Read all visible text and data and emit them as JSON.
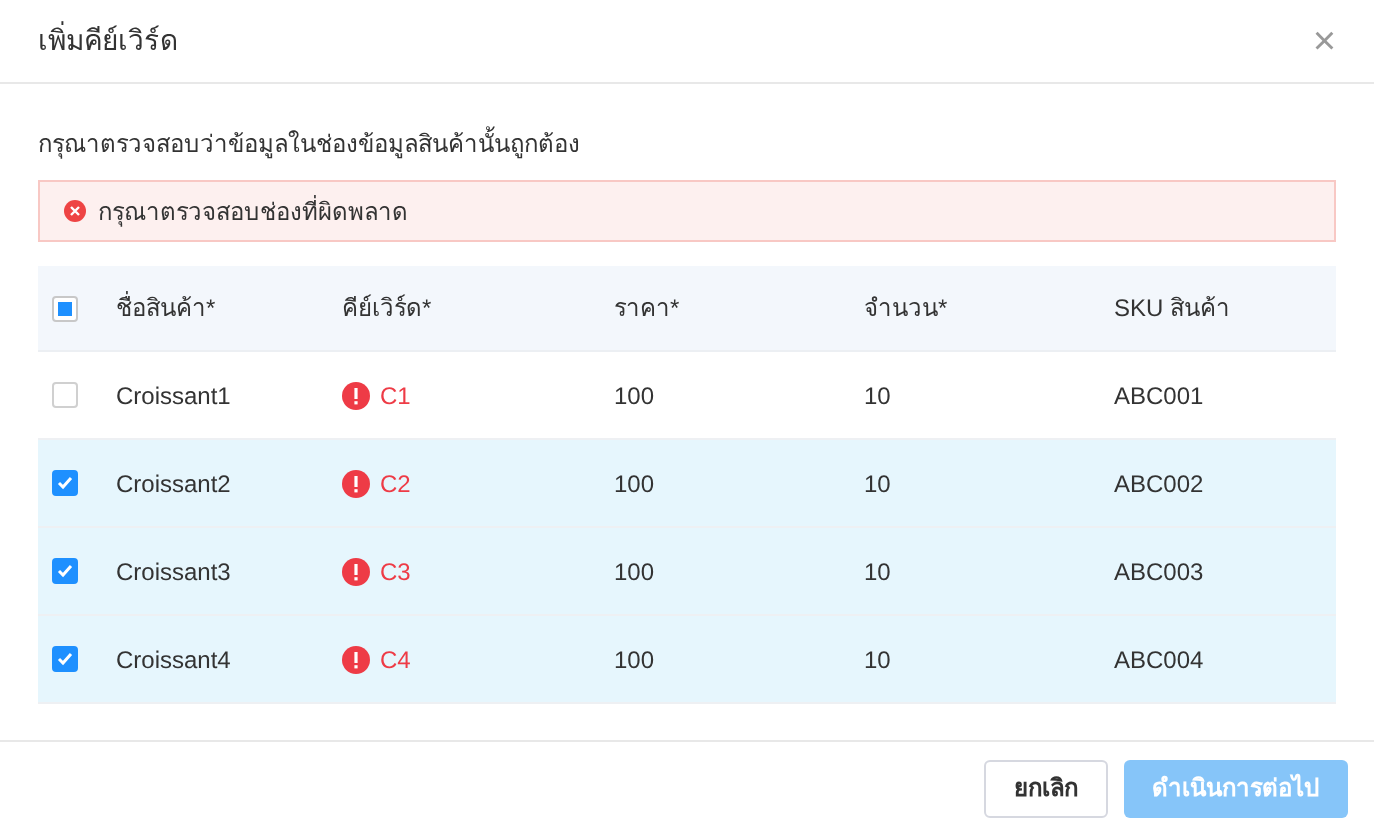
{
  "dialog": {
    "title": "เพิ่มคีย์เวิร์ด",
    "close": "×"
  },
  "instruction": "กรุณาตรวจสอบว่าข้อมูลในช่องข้อมูลสินค้านั้นถูกต้อง",
  "alert": {
    "message": "กรุณาตรวจสอบช่องที่ผิดพลาด"
  },
  "table": {
    "select_all": {
      "indeterminate": true
    },
    "columns": [
      "ชื่อสินค้า*",
      "คีย์เวิร์ด*",
      "ราคา*",
      "จำนวน*",
      "SKU สินค้า"
    ],
    "rows": [
      {
        "selected": false,
        "name": "Croissant1",
        "keyword": "C1",
        "keyword_error": true,
        "price": "100",
        "quantity": "10",
        "sku": "ABC001"
      },
      {
        "selected": true,
        "name": "Croissant2",
        "keyword": "C2",
        "keyword_error": true,
        "price": "100",
        "quantity": "10",
        "sku": "ABC002"
      },
      {
        "selected": true,
        "name": "Croissant3",
        "keyword": "C3",
        "keyword_error": true,
        "price": "100",
        "quantity": "10",
        "sku": "ABC003"
      },
      {
        "selected": true,
        "name": "Croissant4",
        "keyword": "C4",
        "keyword_error": true,
        "price": "100",
        "quantity": "10",
        "sku": "ABC004"
      }
    ]
  },
  "footer": {
    "cancel": {
      "label": "ยกเลิก"
    },
    "proceed": {
      "label": "ดำเนินการต่อไป",
      "disabled": true
    }
  }
}
